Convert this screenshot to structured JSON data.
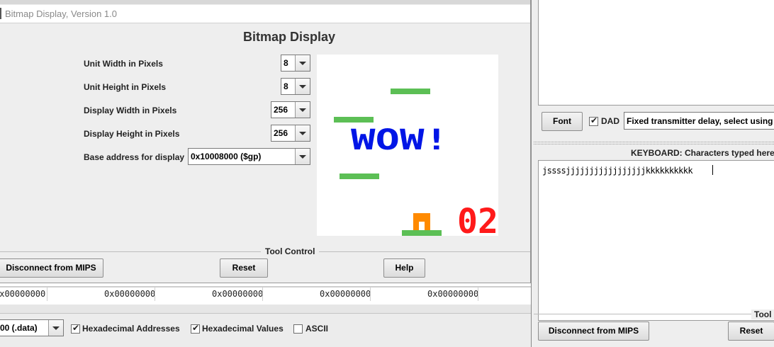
{
  "bitmap_window": {
    "title": "Bitmap Display, Version 1.0",
    "heading": "Bitmap Display",
    "settings": [
      {
        "label": "Unit Width in Pixels",
        "value": "8"
      },
      {
        "label": "Unit Height in Pixels",
        "value": "8"
      },
      {
        "label": "Display Width in Pixels",
        "value": "256"
      },
      {
        "label": "Display Height in Pixels",
        "value": "256"
      },
      {
        "label": "Base address for display",
        "value": "0x10008000 ($gp)"
      }
    ],
    "screen": {
      "banner_text": "WOW!",
      "score": "02",
      "colors": {
        "background": "#ffffff",
        "platform": "#5cbf55",
        "banner": "#0015e6",
        "score": "#ff1a1a",
        "player": "#ff8a00"
      }
    },
    "tool_control_label": "Tool Control",
    "buttons": {
      "disconnect": "Disconnect from MIPS",
      "reset": "Reset",
      "help": "Help"
    }
  },
  "data_segment": {
    "values": [
      "0x00000000",
      "0x00000000",
      "0x00000000",
      "0x00000000",
      "0x00000000"
    ],
    "segment_select": "00 (.data)",
    "options": [
      {
        "label": "Hexadecimal Addresses",
        "checked": true
      },
      {
        "label": "Hexadecimal Values",
        "checked": true
      },
      {
        "label": "ASCII",
        "checked": false
      }
    ]
  },
  "mmio_window": {
    "font_button": "Font",
    "dad_label": "DAD",
    "delay_select": "Fixed transmitter delay, select using",
    "keyboard_header": "KEYBOARD: Characters typed here a",
    "keyboard_text": "jssssjjjjjjjjjjjjjjjjjkkkkkkkkkk",
    "tool_control_label": "Tool C",
    "buttons": {
      "disconnect": "Disconnect from MIPS",
      "reset": "Reset"
    }
  }
}
